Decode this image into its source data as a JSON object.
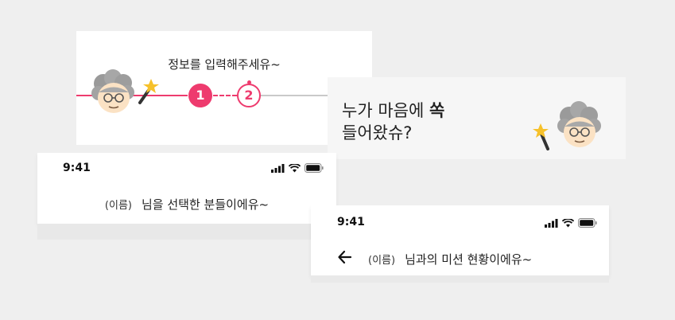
{
  "colors": {
    "accent": "#ee3b6e",
    "track_inactive": "#c9c9c9",
    "background": "#efefef"
  },
  "info_card": {
    "title": "정보를 입력해주세유~",
    "steps": [
      {
        "label": "1",
        "state": "active"
      },
      {
        "label": "2",
        "state": "upcoming"
      }
    ],
    "icons": [
      "grandma-icon",
      "magic-wand-icon"
    ]
  },
  "who_card": {
    "line1_prefix": "누가 마음에 ",
    "line1_emphasis": "쏙",
    "line2": "들어왔슈?",
    "icons": [
      "grandma-icon",
      "magic-wand-icon"
    ]
  },
  "select_card": {
    "status_time": "9:41",
    "name_placeholder": "(이름)",
    "headline": "님을 선택한 분들이에유~",
    "status_icons": [
      "signal-icon",
      "wifi-icon",
      "battery-icon"
    ]
  },
  "mission_card": {
    "status_time": "9:41",
    "name_placeholder": "(이름)",
    "headline": "님과의 미션 현황이에유~",
    "back_icon": "back-arrow-icon",
    "status_icons": [
      "signal-icon",
      "wifi-icon",
      "battery-icon"
    ]
  }
}
